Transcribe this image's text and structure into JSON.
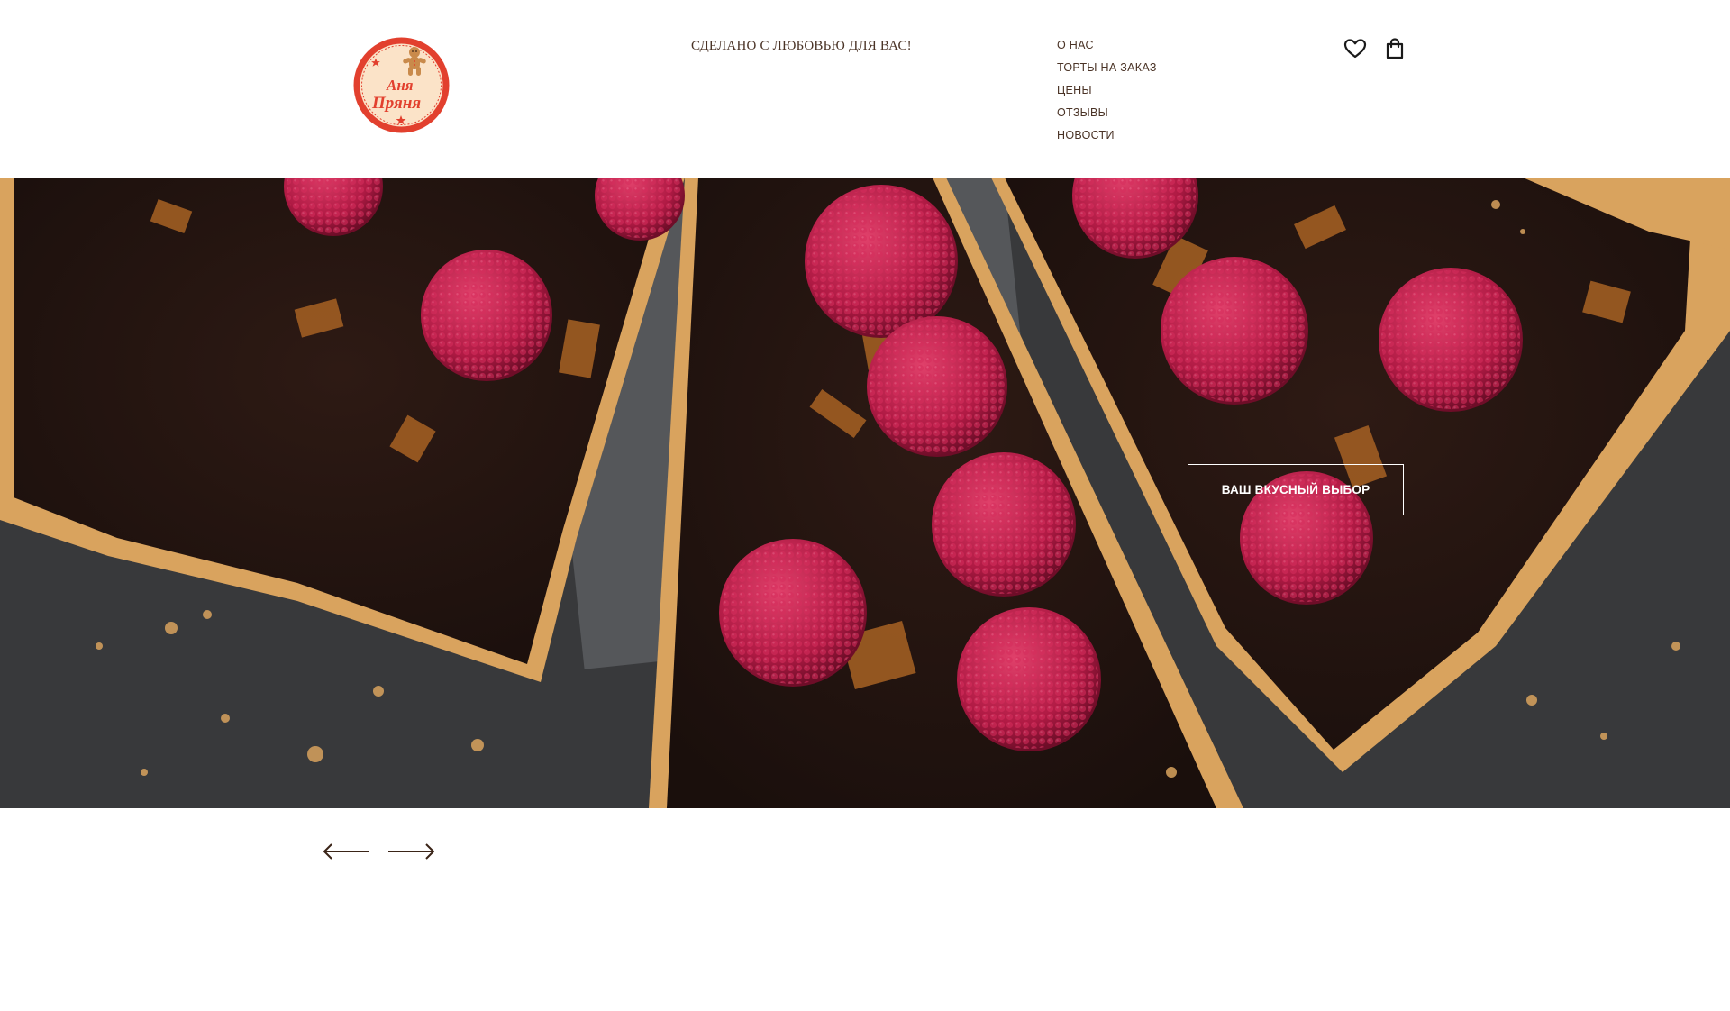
{
  "brand": {
    "logo_text_line1": "Аня",
    "logo_text_line2": "Пряня",
    "logo_icon": "gingerbread-man-icon",
    "logo_colors": {
      "ring": "#e2402e",
      "fill": "#fbe3c8",
      "text": "#e2402e"
    }
  },
  "header": {
    "tagline": "СДЕЛАНО С ЛЮБОВЬЮ ДЛЯ ВАС!",
    "nav": [
      {
        "label": "О НАС"
      },
      {
        "label": "ТОРТЫ НА ЗАКАЗ"
      },
      {
        "label": "ЦЕНЫ"
      },
      {
        "label": "ОТЗЫВЫ"
      },
      {
        "label": "НОВОСТИ"
      }
    ],
    "icons": {
      "favorites": "heart-icon",
      "cart": "shopping-bag-icon"
    }
  },
  "hero": {
    "cta_label": "ВАШ ВКУСНЫЙ ВЫБОР",
    "image": "chocolate-raspberry-tart-photo"
  },
  "slider": {
    "prev_icon": "arrow-left-icon",
    "next_icon": "arrow-right-icon"
  },
  "colors": {
    "text": "#4a3326",
    "background": "#ffffff",
    "hero_dark": "#3a3b3d"
  }
}
